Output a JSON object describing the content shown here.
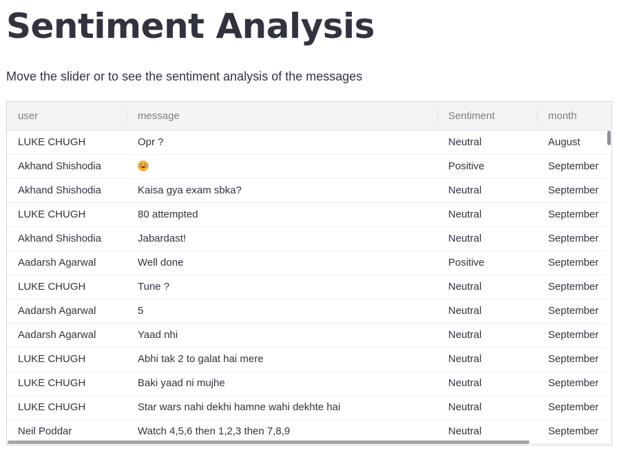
{
  "page": {
    "title": "Sentiment Analysis",
    "subtitle": "Move the slider or to see the sentiment analysis of the messages"
  },
  "table": {
    "columns": [
      "user",
      "message",
      "Sentiment",
      "month"
    ],
    "rows": [
      {
        "user": "LUKE CHUGH",
        "message": "Opr ?",
        "sentiment": "Neutral",
        "month": "August"
      },
      {
        "user": "Akhand Shishodia",
        "message": "",
        "message_icon": "laughing-face-emoji-icon",
        "sentiment": "Positive",
        "month": "September"
      },
      {
        "user": "Akhand Shishodia",
        "message": "Kaisa gya exam sbka?",
        "sentiment": "Neutral",
        "month": "September"
      },
      {
        "user": "LUKE CHUGH",
        "message": "80 attempted",
        "sentiment": "Neutral",
        "month": "September"
      },
      {
        "user": "Akhand Shishodia",
        "message": "Jabardast!",
        "sentiment": "Neutral",
        "month": "September"
      },
      {
        "user": "Aadarsh Agarwal",
        "message": "Well done",
        "sentiment": "Positive",
        "month": "September"
      },
      {
        "user": "LUKE CHUGH",
        "message": "Tune ?",
        "sentiment": "Neutral",
        "month": "September"
      },
      {
        "user": "Aadarsh Agarwal",
        "message": "5",
        "sentiment": "Neutral",
        "month": "September"
      },
      {
        "user": "Aadarsh Agarwal",
        "message": "Yaad nhi",
        "sentiment": "Neutral",
        "month": "September"
      },
      {
        "user": "LUKE CHUGH",
        "message": "Abhi tak 2 to galat hai mere",
        "sentiment": "Neutral",
        "month": "September"
      },
      {
        "user": "LUKE CHUGH",
        "message": "Baki yaad ni mujhe",
        "sentiment": "Neutral",
        "month": "September"
      },
      {
        "user": "LUKE CHUGH",
        "message": "Star wars nahi dekhi hamne wahi dekhte hai",
        "sentiment": "Neutral",
        "month": "September"
      },
      {
        "user": "Neil Poddar",
        "message": "Watch 4,5,6 then 1,2,3 then 7,8,9",
        "sentiment": "Neutral",
        "month": "September"
      }
    ]
  },
  "colors": {
    "text": "#31333f",
    "header_bg": "#f3f4f5",
    "header_text": "#7b7e86",
    "border": "#d5d7db"
  }
}
